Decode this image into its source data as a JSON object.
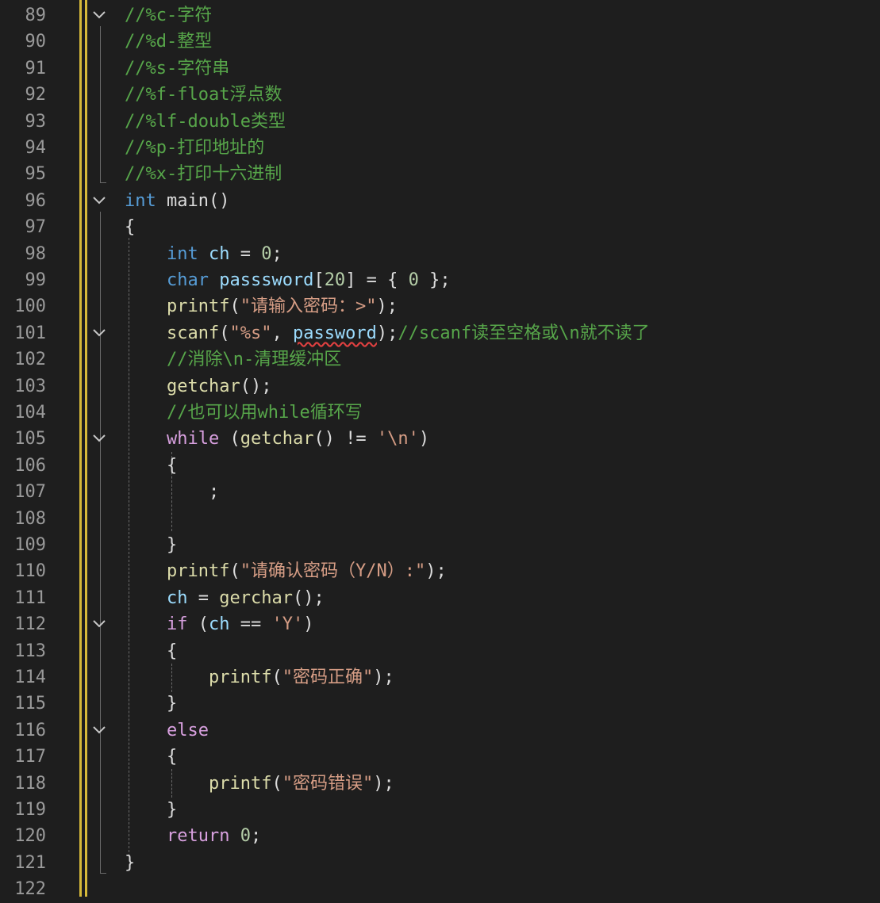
{
  "editor": {
    "colors": {
      "background": "#1e1e1e",
      "line_number": "#9a9a9a",
      "change_bar": "#d7ba3a",
      "comment": "#57a64a",
      "keyword": "#569cd6",
      "control": "#d8a0df",
      "string": "#d69d85",
      "number": "#b5cea8",
      "variable": "#9cdcfe",
      "function": "#dcdcaa",
      "error_squiggle": "#e04040"
    },
    "fold_icon": "chevron-down-icon",
    "lines": [
      {
        "num": "89",
        "fold": true,
        "tokens": [
          {
            "c": "comment",
            "t": "//%c-字符"
          }
        ]
      },
      {
        "num": "90",
        "fold": false,
        "tokens": [
          {
            "c": "comment",
            "t": "//%d-整型"
          }
        ]
      },
      {
        "num": "91",
        "fold": false,
        "tokens": [
          {
            "c": "comment",
            "t": "//%s-字符串"
          }
        ]
      },
      {
        "num": "92",
        "fold": false,
        "tokens": [
          {
            "c": "comment",
            "t": "//%f-float浮点数"
          }
        ]
      },
      {
        "num": "93",
        "fold": false,
        "tokens": [
          {
            "c": "comment",
            "t": "//%lf-double类型"
          }
        ]
      },
      {
        "num": "94",
        "fold": false,
        "tokens": [
          {
            "c": "comment",
            "t": "//%p-打印地址的"
          }
        ]
      },
      {
        "num": "95",
        "fold": false,
        "tokens": [
          {
            "c": "comment",
            "t": "//%x-打印十六进制"
          }
        ]
      },
      {
        "num": "96",
        "fold": true,
        "tokens": [
          {
            "c": "kw",
            "t": "int"
          },
          {
            "c": "punc",
            "t": " main()"
          }
        ]
      },
      {
        "num": "97",
        "fold": false,
        "tokens": [
          {
            "c": "punc",
            "t": "{"
          }
        ]
      },
      {
        "num": "98",
        "fold": false,
        "tokens": [
          {
            "c": "punc",
            "t": "    "
          },
          {
            "c": "kw",
            "t": "int"
          },
          {
            "c": "punc",
            "t": " "
          },
          {
            "c": "var",
            "t": "ch"
          },
          {
            "c": "punc",
            "t": " = "
          },
          {
            "c": "num",
            "t": "0"
          },
          {
            "c": "punc",
            "t": ";"
          }
        ]
      },
      {
        "num": "99",
        "fold": false,
        "tokens": [
          {
            "c": "punc",
            "t": "    "
          },
          {
            "c": "kw",
            "t": "char"
          },
          {
            "c": "punc",
            "t": " "
          },
          {
            "c": "var",
            "t": "passsword"
          },
          {
            "c": "punc",
            "t": "["
          },
          {
            "c": "num",
            "t": "20"
          },
          {
            "c": "punc",
            "t": "] = { "
          },
          {
            "c": "num",
            "t": "0"
          },
          {
            "c": "punc",
            "t": " };"
          }
        ]
      },
      {
        "num": "100",
        "fold": false,
        "tokens": [
          {
            "c": "punc",
            "t": "    "
          },
          {
            "c": "fn",
            "t": "printf"
          },
          {
            "c": "punc",
            "t": "("
          },
          {
            "c": "str",
            "t": "\"请输入密码：>\""
          },
          {
            "c": "punc",
            "t": ");"
          }
        ]
      },
      {
        "num": "101",
        "fold": true,
        "tokens": [
          {
            "c": "punc",
            "t": "    "
          },
          {
            "c": "fn",
            "t": "scanf"
          },
          {
            "c": "punc",
            "t": "("
          },
          {
            "c": "str",
            "t": "\"%s\""
          },
          {
            "c": "punc",
            "t": ", "
          },
          {
            "c": "err",
            "t": "password"
          },
          {
            "c": "punc",
            "t": ");"
          },
          {
            "c": "comment",
            "t": "//scanf读至空格或\\n就不读了"
          }
        ]
      },
      {
        "num": "102",
        "fold": false,
        "tokens": [
          {
            "c": "punc",
            "t": "    "
          },
          {
            "c": "comment",
            "t": "//消除\\n-清理缓冲区"
          }
        ]
      },
      {
        "num": "103",
        "fold": false,
        "tokens": [
          {
            "c": "punc",
            "t": "    "
          },
          {
            "c": "fn",
            "t": "getchar"
          },
          {
            "c": "punc",
            "t": "();"
          }
        ]
      },
      {
        "num": "104",
        "fold": false,
        "tokens": [
          {
            "c": "punc",
            "t": "    "
          },
          {
            "c": "comment",
            "t": "//也可以用while循环写"
          }
        ]
      },
      {
        "num": "105",
        "fold": true,
        "tokens": [
          {
            "c": "punc",
            "t": "    "
          },
          {
            "c": "ctrl",
            "t": "while"
          },
          {
            "c": "punc",
            "t": " ("
          },
          {
            "c": "fn",
            "t": "getchar"
          },
          {
            "c": "punc",
            "t": "() != "
          },
          {
            "c": "str",
            "t": "'\\n'"
          },
          {
            "c": "punc",
            "t": ")"
          }
        ]
      },
      {
        "num": "106",
        "fold": false,
        "tokens": [
          {
            "c": "punc",
            "t": "    {"
          }
        ]
      },
      {
        "num": "107",
        "fold": false,
        "tokens": [
          {
            "c": "punc",
            "t": "        ;"
          }
        ]
      },
      {
        "num": "108",
        "fold": false,
        "tokens": []
      },
      {
        "num": "109",
        "fold": false,
        "tokens": [
          {
            "c": "punc",
            "t": "    }"
          }
        ]
      },
      {
        "num": "110",
        "fold": false,
        "tokens": [
          {
            "c": "punc",
            "t": "    "
          },
          {
            "c": "fn",
            "t": "printf"
          },
          {
            "c": "punc",
            "t": "("
          },
          {
            "c": "str",
            "t": "\"请确认密码（Y/N）:\""
          },
          {
            "c": "punc",
            "t": ");"
          }
        ]
      },
      {
        "num": "111",
        "fold": false,
        "tokens": [
          {
            "c": "punc",
            "t": "    "
          },
          {
            "c": "var",
            "t": "ch"
          },
          {
            "c": "punc",
            "t": " = "
          },
          {
            "c": "fn",
            "t": "gerchar"
          },
          {
            "c": "punc",
            "t": "();"
          }
        ]
      },
      {
        "num": "112",
        "fold": true,
        "tokens": [
          {
            "c": "punc",
            "t": "    "
          },
          {
            "c": "ctrl",
            "t": "if"
          },
          {
            "c": "punc",
            "t": " ("
          },
          {
            "c": "var",
            "t": "ch"
          },
          {
            "c": "punc",
            "t": " == "
          },
          {
            "c": "str",
            "t": "'Y'"
          },
          {
            "c": "punc",
            "t": ")"
          }
        ]
      },
      {
        "num": "113",
        "fold": false,
        "tokens": [
          {
            "c": "punc",
            "t": "    {"
          }
        ]
      },
      {
        "num": "114",
        "fold": false,
        "tokens": [
          {
            "c": "punc",
            "t": "        "
          },
          {
            "c": "fn",
            "t": "printf"
          },
          {
            "c": "punc",
            "t": "("
          },
          {
            "c": "str",
            "t": "\"密码正确\""
          },
          {
            "c": "punc",
            "t": ");"
          }
        ]
      },
      {
        "num": "115",
        "fold": false,
        "tokens": [
          {
            "c": "punc",
            "t": "    }"
          }
        ]
      },
      {
        "num": "116",
        "fold": true,
        "tokens": [
          {
            "c": "punc",
            "t": "    "
          },
          {
            "c": "ctrl",
            "t": "else"
          }
        ]
      },
      {
        "num": "117",
        "fold": false,
        "tokens": [
          {
            "c": "punc",
            "t": "    {"
          }
        ]
      },
      {
        "num": "118",
        "fold": false,
        "tokens": [
          {
            "c": "punc",
            "t": "        "
          },
          {
            "c": "fn",
            "t": "printf"
          },
          {
            "c": "punc",
            "t": "("
          },
          {
            "c": "str",
            "t": "\"密码错误\""
          },
          {
            "c": "punc",
            "t": ");"
          }
        ]
      },
      {
        "num": "119",
        "fold": false,
        "tokens": [
          {
            "c": "punc",
            "t": "    }"
          }
        ]
      },
      {
        "num": "120",
        "fold": false,
        "tokens": [
          {
            "c": "punc",
            "t": "    "
          },
          {
            "c": "ctrl",
            "t": "return"
          },
          {
            "c": "punc",
            "t": " "
          },
          {
            "c": "num",
            "t": "0"
          },
          {
            "c": "punc",
            "t": ";"
          }
        ]
      },
      {
        "num": "121",
        "fold": false,
        "tokens": [
          {
            "c": "punc",
            "t": "}"
          }
        ]
      },
      {
        "num": "122",
        "fold": false,
        "tokens": []
      }
    ]
  }
}
